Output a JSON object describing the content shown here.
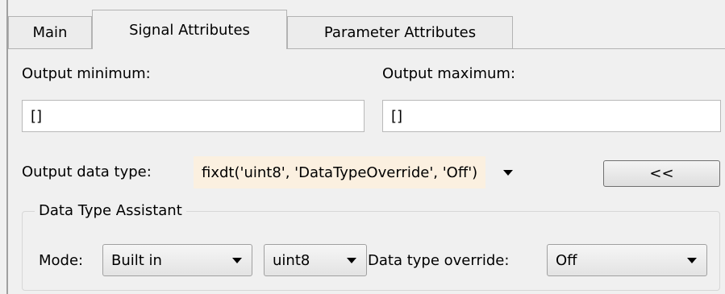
{
  "tabs": [
    {
      "label": "Main"
    },
    {
      "label": "Signal Attributes"
    },
    {
      "label": "Parameter Attributes"
    }
  ],
  "output_minimum": {
    "label": "Output minimum:",
    "value": "[]"
  },
  "output_maximum": {
    "label": "Output maximum:",
    "value": "[]"
  },
  "output_data_type": {
    "label": "Output data type:",
    "value": "fixdt('uint8', 'DataTypeOverride', 'Off')",
    "value_bg": "#fbf0e0"
  },
  "assistant_toggle": {
    "label": "<<"
  },
  "data_type_assistant": {
    "title": "Data Type Assistant",
    "mode_label": "Mode:",
    "mode_value": "Built in",
    "type_value": "uint8",
    "override_label": "Data type override:",
    "override_value": "Off"
  }
}
